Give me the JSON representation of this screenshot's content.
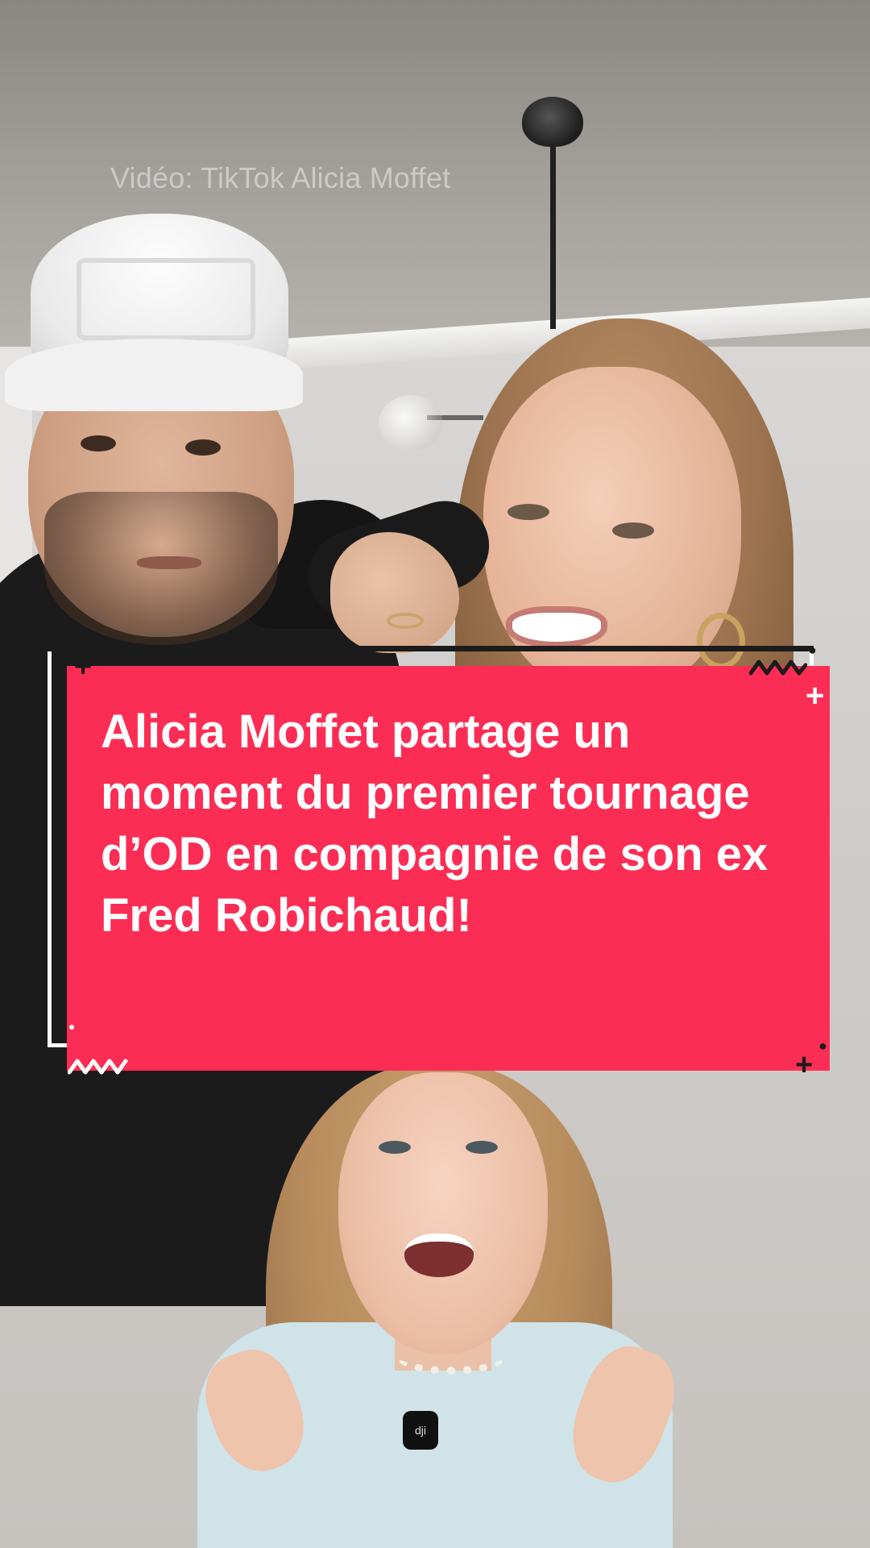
{
  "video": {
    "watermark": "Vidéo: TikTok Alicia Moffet"
  },
  "headline": {
    "text": "Alicia Moffet partage un moment du premier tournage d’OD en compagnie de son ex Fred Robichaud!"
  },
  "microphone": {
    "brand_mark": "dji"
  },
  "colors": {
    "card": "#fc2d54",
    "frame": "#ffffff",
    "dark_accent": "#1b1b1b"
  }
}
